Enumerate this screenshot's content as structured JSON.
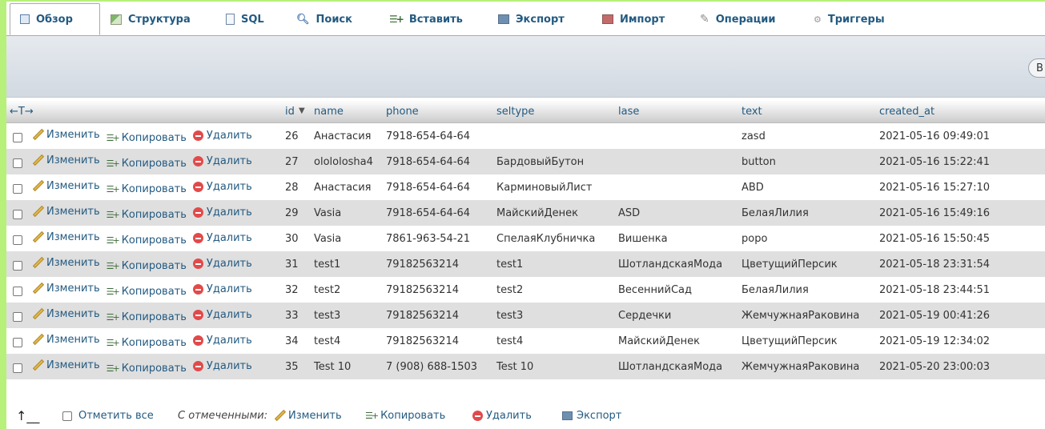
{
  "tabs": [
    {
      "label": "Обзор",
      "icon": "browse-icon"
    },
    {
      "label": "Структура",
      "icon": "structure-icon"
    },
    {
      "label": "SQL",
      "icon": "sql-icon"
    },
    {
      "label": "Поиск",
      "icon": "search-icon"
    },
    {
      "label": "Вставить",
      "icon": "insert-icon"
    },
    {
      "label": "Экспорт",
      "icon": "export-icon"
    },
    {
      "label": "Импорт",
      "icon": "import-icon"
    },
    {
      "label": "Операции",
      "icon": "wrench-icon"
    },
    {
      "label": "Триггеры",
      "icon": "triggers-icon"
    }
  ],
  "toolbar": {
    "partial_button": "В"
  },
  "table": {
    "arrows_label": "←T→",
    "columns": [
      "id",
      "name",
      "phone",
      "seltype",
      "lase",
      "text",
      "created_at"
    ],
    "action_edit": "Изменить",
    "action_copy": "Копировать",
    "action_delete": "Удалить",
    "rows": [
      {
        "id": "26",
        "name": "Анастасия",
        "phone": "7918-654-64-64",
        "seltype": "",
        "lase": "",
        "text": "zasd",
        "created_at": "2021-05-16 09:49:01"
      },
      {
        "id": "27",
        "name": "olololosha4",
        "phone": "7918-654-64-64",
        "seltype": "БардовыйБутон",
        "lase": "",
        "text": "button",
        "created_at": "2021-05-16 15:22:41"
      },
      {
        "id": "28",
        "name": "Анастасия",
        "phone": "7918-654-64-64",
        "seltype": "КарминовыйЛист",
        "lase": "",
        "text": "ABD",
        "created_at": "2021-05-16 15:27:10"
      },
      {
        "id": "29",
        "name": "Vasia",
        "phone": "7918-654-64-64",
        "seltype": "МайскийДенек",
        "lase": "ASD",
        "text": "БелаяЛилия",
        "created_at": "2021-05-16 15:49:16"
      },
      {
        "id": "30",
        "name": "Vasia",
        "phone": "7861-963-54-21",
        "seltype": "СпелаяКлубничка",
        "lase": "Вишенка",
        "text": "popo",
        "created_at": "2021-05-16 15:50:45"
      },
      {
        "id": "31",
        "name": "test1",
        "phone": "79182563214",
        "seltype": "test1",
        "lase": "ШотландскаяМода",
        "text": "ЦветущийПерсик",
        "created_at": "2021-05-18 23:31:54"
      },
      {
        "id": "32",
        "name": "test2",
        "phone": "79182563214",
        "seltype": "test2",
        "lase": "ВесеннийСад",
        "text": "БелаяЛилия",
        "created_at": "2021-05-18 23:44:51"
      },
      {
        "id": "33",
        "name": "test3",
        "phone": "79182563214",
        "seltype": "test3",
        "lase": "Сердечки",
        "text": "ЖемчужнаяРаковина",
        "created_at": "2021-05-19 00:41:26"
      },
      {
        "id": "34",
        "name": "test4",
        "phone": "79182563214",
        "seltype": "test4",
        "lase": "МайскийДенек",
        "text": "ЦветущийПерсик",
        "created_at": "2021-05-19 12:34:02"
      },
      {
        "id": "35",
        "name": "Test 10",
        "phone": "7 (908) 688-1503",
        "seltype": "Test 10",
        "lase": "ШотландскаяМода",
        "text": "ЖемчужнаяРаковина",
        "created_at": "2021-05-20 23:00:03"
      }
    ]
  },
  "footer": {
    "check_all": "Отметить все",
    "with_selected": "С отмеченными:",
    "edit": "Изменить",
    "copy": "Копировать",
    "delete": "Удалить",
    "export": "Экспорт"
  },
  "colors": {
    "background": "#b7f07a",
    "link": "#235a81",
    "even_row": "#dfdfdf"
  }
}
